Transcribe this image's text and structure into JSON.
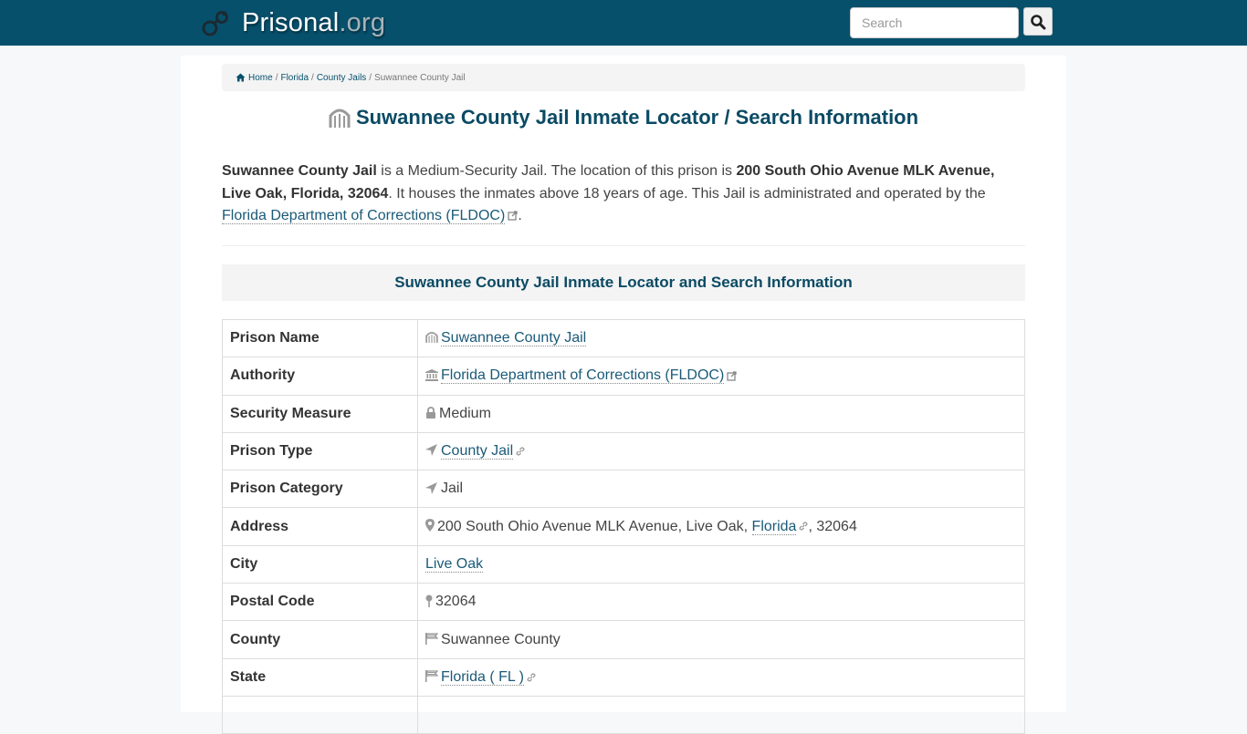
{
  "navbar": {
    "brand_name": "Prisonal",
    "brand_tld": ".org",
    "logo_icon": "handcuffs-icon",
    "search_placeholder": "Search",
    "search_value": "",
    "search_icon": "search-icon"
  },
  "breadcrumb": {
    "items": [
      {
        "label": "Home",
        "icon": "home-icon",
        "link": true
      },
      {
        "label": "Florida",
        "link": true
      },
      {
        "label": "County Jails",
        "link": true
      },
      {
        "label": "Suwannee County Jail",
        "link": false
      }
    ],
    "separator": "/"
  },
  "page": {
    "title": "Suwannee County Jail Inmate Locator / Search Information",
    "title_icon": "jail-gate-icon"
  },
  "intro": {
    "name": "Suwannee County Jail",
    "text1": " is a Medium-Security Jail. The location of this prison is ",
    "address": "200 South Ohio Avenue MLK Avenue, Live Oak, Florida, 32064",
    "text2": ". It houses the inmates above 18 years of age. This Jail is administrated and operated by the ",
    "authority_link": "Florida Department of Corrections (FLDOC)",
    "text3": "."
  },
  "section": {
    "heading": "Suwannee County Jail Inmate Locator and Search Information"
  },
  "table": {
    "rows": [
      {
        "key": "Prison Name",
        "icon": "jail-gate-icon",
        "value": "Suwannee County Jail",
        "link": true,
        "suffix_icon": null
      },
      {
        "key": "Authority",
        "icon": "institution-icon",
        "value": "Florida Department of Corrections (FLDOC)",
        "link": true,
        "suffix_icon": "external-link-icon"
      },
      {
        "key": "Security Measure",
        "icon": "lock-icon",
        "value": "Medium",
        "link": false,
        "suffix_icon": null
      },
      {
        "key": "Prison Type",
        "icon": "location-arrow-icon",
        "value": "County Jail",
        "link": true,
        "suffix_icon": "chain-link-icon"
      },
      {
        "key": "Prison Category",
        "icon": "location-arrow-icon",
        "value": "Jail",
        "link": false,
        "suffix_icon": null
      },
      {
        "key": "Address",
        "icon": "map-marker-icon",
        "value_prefix": "200 South Ohio Avenue MLK Avenue, Live Oak, ",
        "value": "Florida",
        "value_suffix": ", 32064",
        "link": true,
        "suffix_icon": "chain-link-icon"
      },
      {
        "key": "City",
        "icon": null,
        "value": "Live Oak",
        "link": true,
        "suffix_icon": null
      },
      {
        "key": "Postal Code",
        "icon": "map-pin-icon",
        "value": "32064",
        "link": false,
        "suffix_icon": null
      },
      {
        "key": "County",
        "icon": "flag-icon",
        "value": "Suwannee County",
        "link": false,
        "suffix_icon": null
      },
      {
        "key": "State",
        "icon": "flag-icon",
        "value": "Florida ( FL )",
        "link": true,
        "suffix_icon": "chain-link-icon"
      }
    ]
  },
  "colors": {
    "navbar_bg": "#07506c",
    "heading": "#0b4a64",
    "link": "#1a5a78",
    "panel_bg": "#f4f4f4",
    "page_bg": "#f7f8fa"
  }
}
